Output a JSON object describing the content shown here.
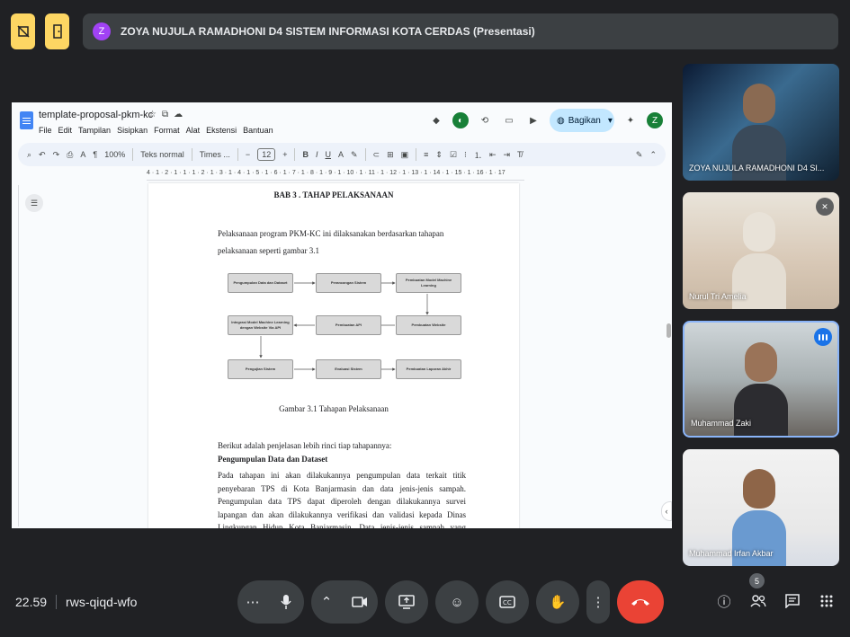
{
  "top": {
    "presenter_initial": "Z",
    "presenter_title": "ZOYA NUJULA RAMADHONI D4 SISTEM INFORMASI KOTA CERDAS (Presentasi)"
  },
  "doc": {
    "title": "template-proposal-pkm-kc",
    "menu": [
      "File",
      "Edit",
      "Tampilan",
      "Sisipkan",
      "Format",
      "Alat",
      "Ekstensi",
      "Bantuan"
    ],
    "share_label": "Bagikan",
    "user_initial": "Z",
    "toolbar": {
      "zoom": "100%",
      "style": "Teks normal",
      "font": "Times ...",
      "font_size": "12"
    },
    "ruler": "4 · 1 · 2 · 1 · 1 · 1 · 2 · 1 · 3 · 1 · 4 · 1 · 5 · 1 · 6 · 1 · 7 · 1 · 8 · 1 · 9 · 1 · 10 · 1 · 11 · 1 · 12 · 1 · 13 · 1 · 14 · 1 · 15 · 1 · 16 · 1 · 17",
    "heading": "BAB 3 . TAHAP PELAKSANAAN",
    "intro_line1": "Pelaksanaan program PKM-KC ini dilaksanakan berdasarkan tahapan",
    "intro_line2": "pelaksanaan seperti gambar 3.1",
    "diagram": {
      "boxes": [
        "Pengumpulan Data dan Dataset",
        "Perancangan Sistem",
        "Pembuatan Model Machine Learning",
        "Integrasi Model Machine Learning dengan Website Via API",
        "Pembuatan API",
        "Pembuatan Website",
        "Pengujian Sistem",
        "Evaluasi Sistem",
        "Pembuatan Laporan Akhir"
      ]
    },
    "caption": "Gambar 3.1 Tahapan Pelaksanaan",
    "explain_line": "Berikut adalah penjelasan lebih rinci tiap tahapannya:",
    "subheading": "Pengumpulan Data dan Dataset",
    "body": "Pada tahapan ini akan dilakukannya pengumpulan data terkait titik penyebaran TPS di Kota Banjarmasin dan data jenis-jenis sampah. Pengumpulan data TPS dapat diperoleh dengan dilakukannya survei lapangan dan akan dilakukannya verifikasi dan validasi kepada Dinas Lingkungan Hidup Kota Banjarmasin. Data jenis-jenis sampah yang dibutuhkan untuk optimalisasi pada sistem ..."
  },
  "participants": [
    {
      "name": "ZOYA NUJULA RAMADHONI D4 SI..."
    },
    {
      "name": "Nurul Tri Amelia"
    },
    {
      "name": "Muhammad Zaki"
    },
    {
      "name": "Muhammad Irfan Akbar"
    }
  ],
  "bottom": {
    "time": "22.59",
    "meeting_code": "rws-qiqd-wfo",
    "people_count": "5"
  },
  "colors": {
    "background": "#202124",
    "end_call": "#ea4335",
    "share": "#c2e7ff",
    "highlight_yellow": "#fdd663"
  }
}
